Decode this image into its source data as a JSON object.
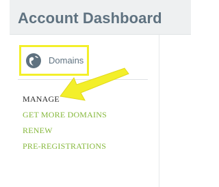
{
  "header": {
    "title": "Account Dashboard"
  },
  "product": {
    "label": "Domains",
    "icon": "domains-globe-icon"
  },
  "menu": {
    "items": [
      {
        "label": "MANAGE",
        "active": true
      },
      {
        "label": "GET MORE DOMAINS",
        "active": false
      },
      {
        "label": "RENEW",
        "active": false
      },
      {
        "label": "PRE-REGISTRATIONS",
        "active": false
      }
    ]
  },
  "annotation": {
    "highlight_color": "#f3ef2a",
    "arrow_color": "#f3ef2a",
    "points_to": "MANAGE"
  },
  "colors": {
    "title": "#5f7280",
    "link": "#86b83c",
    "active": "#2b2b2b",
    "header_bg": "#eef0f1"
  }
}
